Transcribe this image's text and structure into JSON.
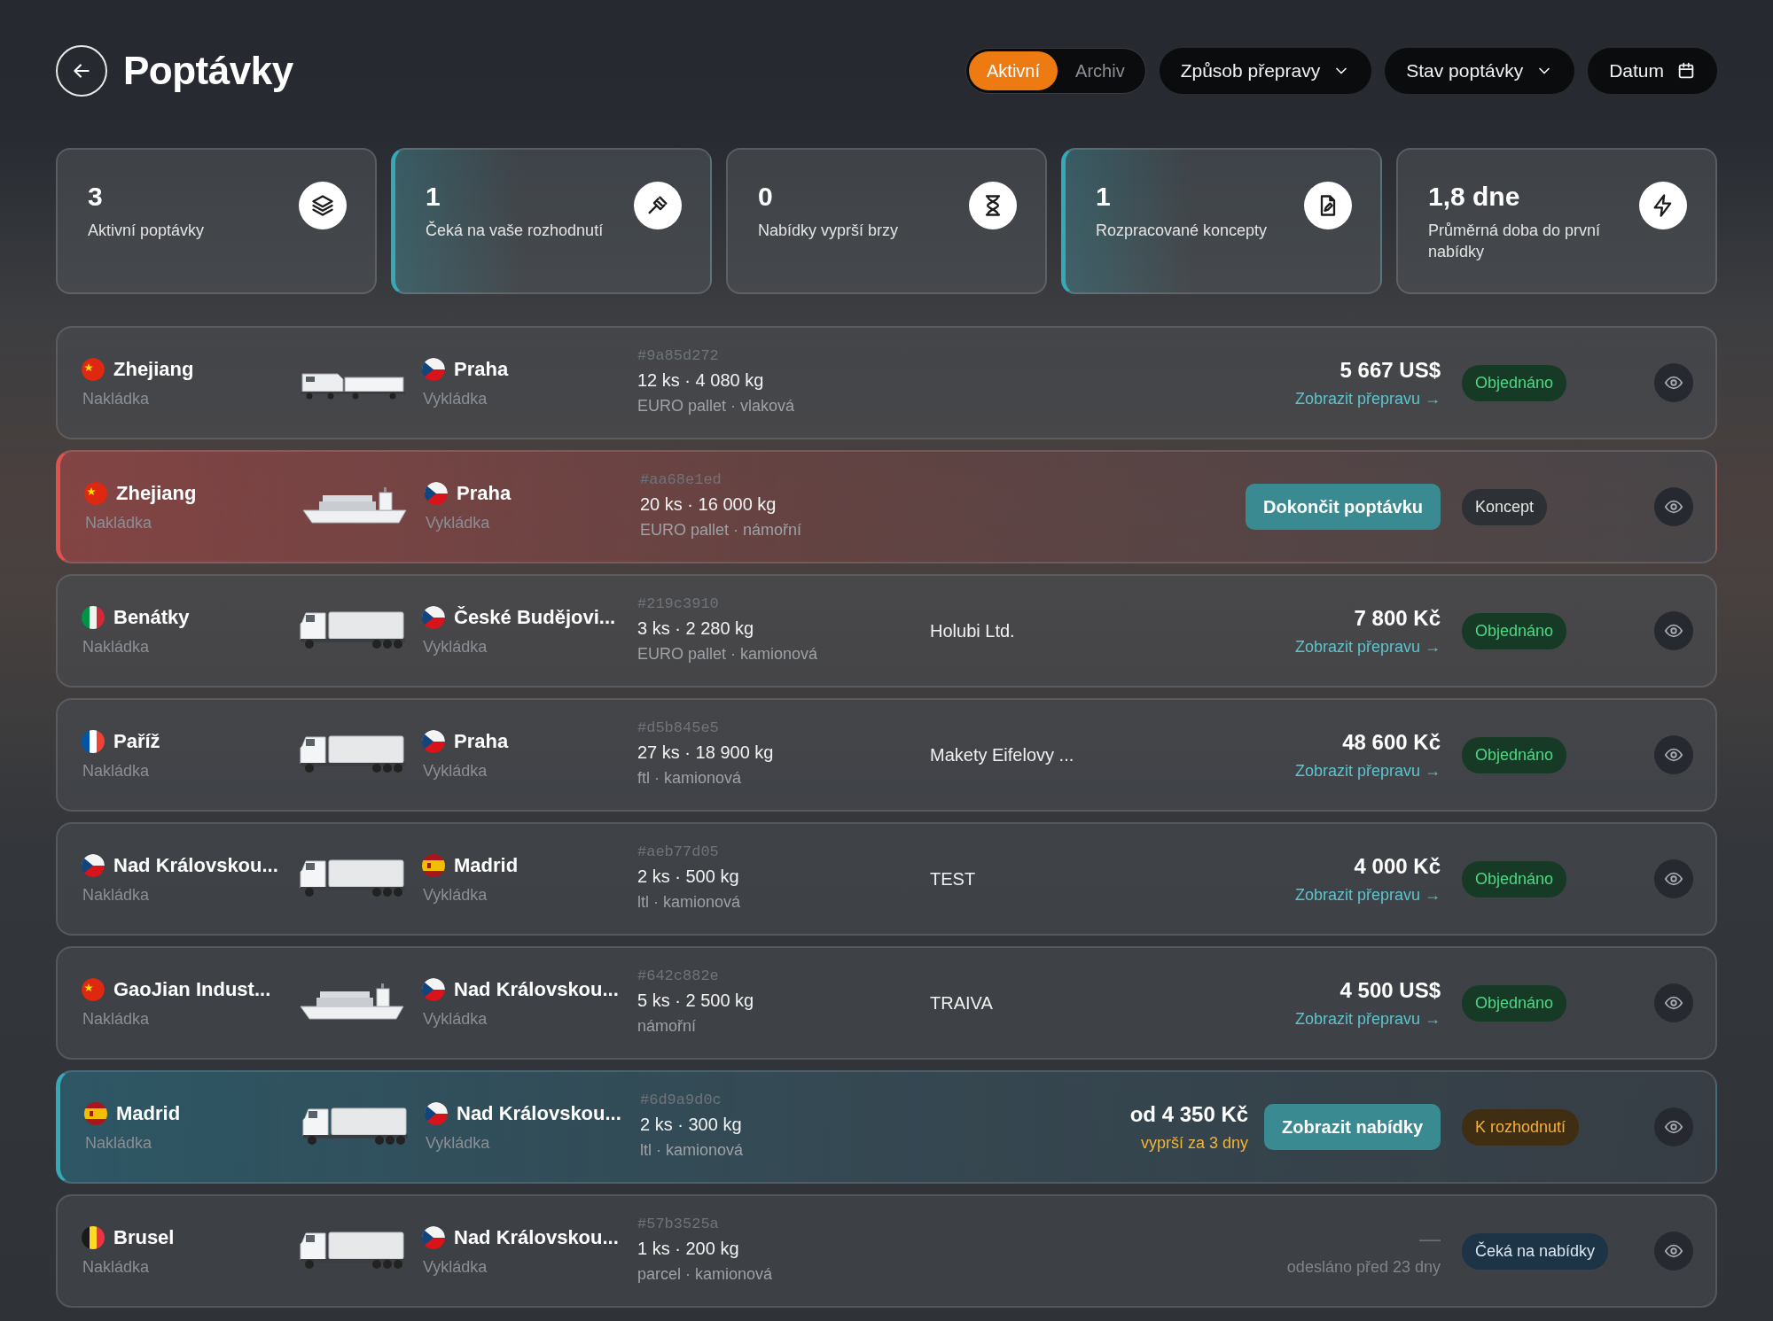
{
  "header": {
    "title": "Poptávky",
    "segments": [
      {
        "label": "Aktivní",
        "selected": true
      },
      {
        "label": "Archiv",
        "selected": false
      }
    ],
    "filters": [
      {
        "label": "Způsob přepravy",
        "kind": "dropdown"
      },
      {
        "label": "Stav poptávky",
        "kind": "dropdown"
      },
      {
        "label": "Datum",
        "kind": "date"
      }
    ]
  },
  "stats": [
    {
      "value": "3",
      "label": "Aktivní poptávky",
      "highlighted": false
    },
    {
      "value": "1",
      "label": "Čeká na vaše rozhodnutí",
      "highlighted": true
    },
    {
      "value": "0",
      "label": "Nabídky vyprší brzy",
      "highlighted": false
    },
    {
      "value": "1",
      "label": "Rozpracované koncepty",
      "highlighted": true
    },
    {
      "value": "1,8 dne",
      "label": "Průměrná doba do první nabídky",
      "highlighted": false
    }
  ],
  "rows": [
    {
      "kind": "default",
      "origin": {
        "name": "Zhejiang",
        "flag": {
          "kind": "cn"
        },
        "label": "Nakládka"
      },
      "vehicle": {
        "kind": "train"
      },
      "destination": {
        "name": "Praha",
        "flag": {
          "kind": "cz"
        },
        "label": "Vykládka"
      },
      "id": "#9a85d272",
      "cargo": "12 ks · 4 080 kg",
      "details": "EURO pallet · vlaková",
      "price": "5 667 US$",
      "price_muted": false,
      "note": {
        "text": "Zobrazit přepravu →",
        "kind": "link"
      },
      "status": {
        "label": "Objednáno",
        "kind": "ordered"
      }
    },
    {
      "kind": "draft",
      "origin": {
        "name": "Zhejiang",
        "flag": {
          "kind": "cn"
        },
        "label": "Nakládka"
      },
      "vehicle": {
        "kind": "ship"
      },
      "destination": {
        "name": "Praha",
        "flag": {
          "kind": "cz"
        },
        "label": "Vykládka"
      },
      "id": "#aa68e1ed",
      "cargo": "20 ks · 16 000 kg",
      "details": "EURO pallet · námořní",
      "button": "Dokončit poptávku",
      "status": {
        "label": "Koncept",
        "kind": "draft"
      }
    },
    {
      "kind": "default",
      "origin": {
        "name": "Benátky",
        "flag": {
          "kind": "it"
        },
        "label": "Nakládka"
      },
      "vehicle": {
        "kind": "truck"
      },
      "destination": {
        "name": "České Budějovi...",
        "flag": {
          "kind": "cz"
        },
        "label": "Vykládka"
      },
      "id": "#219c3910",
      "cargo": "3 ks · 2 280 kg",
      "details": "EURO pallet · kamionová",
      "company": "Holubi Ltd.",
      "price": "7 800 Kč",
      "price_muted": false,
      "note": {
        "text": "Zobrazit přepravu →",
        "kind": "link"
      },
      "status": {
        "label": "Objednáno",
        "kind": "ordered"
      }
    },
    {
      "kind": "default",
      "origin": {
        "name": "Paříž",
        "flag": {
          "kind": "fr"
        },
        "label": "Nakládka"
      },
      "vehicle": {
        "kind": "truck"
      },
      "destination": {
        "name": "Praha",
        "flag": {
          "kind": "cz"
        },
        "label": "Vykládka"
      },
      "id": "#d5b845e5",
      "cargo": "27 ks · 18 900 kg",
      "details": "ftl · kamionová",
      "company": "Makety Eifelovy ...",
      "price": "48 600 Kč",
      "price_muted": false,
      "note": {
        "text": "Zobrazit přepravu →",
        "kind": "link"
      },
      "status": {
        "label": "Objednáno",
        "kind": "ordered"
      }
    },
    {
      "kind": "default",
      "origin": {
        "name": "Nad Královskou...",
        "flag": {
          "kind": "cz"
        },
        "label": "Nakládka"
      },
      "vehicle": {
        "kind": "truck"
      },
      "destination": {
        "name": "Madrid",
        "flag": {
          "kind": "es"
        },
        "label": "Vykládka"
      },
      "id": "#aeb77d05",
      "cargo": "2 ks · 500 kg",
      "details": "ltl · kamionová",
      "company": "TEST",
      "price": "4 000 Kč",
      "price_muted": false,
      "note": {
        "text": "Zobrazit přepravu →",
        "kind": "link"
      },
      "status": {
        "label": "Objednáno",
        "kind": "ordered"
      }
    },
    {
      "kind": "default",
      "origin": {
        "name": "GaoJian Indust...",
        "flag": {
          "kind": "cn"
        },
        "label": "Nakládka"
      },
      "vehicle": {
        "kind": "ship"
      },
      "destination": {
        "name": "Nad Královskou...",
        "flag": {
          "kind": "cz"
        },
        "label": "Vykládka"
      },
      "id": "#642c882e",
      "cargo": "5 ks · 2 500 kg",
      "details": "námořní",
      "company": "TRAIVA",
      "price": "4 500 US$",
      "price_muted": false,
      "note": {
        "text": "Zobrazit přepravu →",
        "kind": "link"
      },
      "status": {
        "label": "Objednáno",
        "kind": "ordered"
      }
    },
    {
      "kind": "decision",
      "origin": {
        "name": "Madrid",
        "flag": {
          "kind": "es"
        },
        "label": "Nakládka"
      },
      "vehicle": {
        "kind": "truck"
      },
      "destination": {
        "name": "Nad Královskou...",
        "flag": {
          "kind": "cz"
        },
        "label": "Vykládka"
      },
      "id": "#6d9a9d0c",
      "cargo": "2 ks · 300 kg",
      "details": "ltl · kamionová",
      "price": "od 4 350 Kč",
      "price_muted": false,
      "note": {
        "text": "vyprší za 3 dny",
        "kind": "warning"
      },
      "button": "Zobrazit nabídky",
      "status": {
        "label": "K rozhodnutí",
        "kind": "decision"
      }
    },
    {
      "kind": "default",
      "origin": {
        "name": "Brusel",
        "flag": {
          "kind": "be"
        },
        "label": "Nakládka"
      },
      "vehicle": {
        "kind": "truck"
      },
      "destination": {
        "name": "Nad Královskou...",
        "flag": {
          "kind": "cz"
        },
        "label": "Vykládka"
      },
      "id": "#57b3525a",
      "cargo": "1 ks · 200 kg",
      "details": "parcel · kamionová",
      "price": "—",
      "price_muted": true,
      "note": {
        "text": "odesláno před 23 dny",
        "kind": "muted"
      },
      "status": {
        "label": "Čeká na nabídky",
        "kind": "waiting"
      }
    }
  ]
}
